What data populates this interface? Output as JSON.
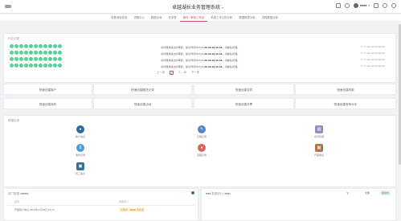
{
  "header": {
    "title": "卓越湖长业务管理系统",
    "title_arrow": "▾",
    "user_name": "■■■■",
    "user_arrow": "▾"
  },
  "nav": {
    "items": [
      "查看消息信息",
      "流程中心",
      "数据仓库",
      "任务表",
      "事件 / 审批工作台",
      "系统工作日历分析",
      "数据报表分析",
      "流程数据分析"
    ],
    "active_index": 4
  },
  "approval": {
    "title": "代办记录",
    "rows": [
      {
        "text": "请处理我提交的审批，提交时间为2021-■■-■■ ■■:■■:■■，请前往处理。",
        "time": "2021-■■-■■ ■■:■■:■■"
      },
      {
        "text": "请处理我提交的审批，提交时间为2021-■■-■■ ■■:■■:■■，请前往处理。",
        "time": "2021-■■-■■ ■■:■■:■■"
      },
      {
        "text": "请处理我提交的审批，提交时间为2021-■■-■■ ■■:■■:■■，请前往处理。",
        "time": "2021-■■-■■ ■■:■■:■■"
      },
      {
        "text": "请处理我提交的审批，提交时间为2021-■■-■■ ■■:■■:■■，请前往处理。",
        "time": "2021-■■-■■ ■■:■■:■■"
      }
    ],
    "pager": {
      "prev": "上一页",
      "current": "1",
      "next_pages": "2 ... 16",
      "next": "下一页"
    }
  },
  "quick_actions": [
    "快速创建客户",
    "快速创建跟进记录",
    "快速创建合同",
    "快速创建收款",
    "快速创建商机",
    "快速创建活动",
    "快速创建开票",
    "快速创建竞争对手"
  ],
  "tools": {
    "title": "快捷应用",
    "items": [
      {
        "label": "客户信息",
        "icon": "user-icon",
        "color": "#2d6aa0"
      },
      {
        "label": "日程记录",
        "icon": "pencil-icon",
        "color": "#5585c2"
      },
      {
        "label": "合同管理",
        "icon": "doc-icon",
        "color": "#9c8bbf"
      },
      {
        "label": "收款记录",
        "icon": "info-icon",
        "color": "#4a9be0"
      },
      {
        "label": "流程记录",
        "icon": "clip-icon",
        "color": "#d46655"
      },
      {
        "label": "开票信息",
        "icon": "invoice-icon",
        "color": "#b0724a"
      },
      {
        "label": "员工信息",
        "icon": "user-card-icon",
        "color": "#3a6f9a"
      }
    ]
  },
  "bottom_left": {
    "title": "部门数据 (■■■■)",
    "col1": "名称",
    "col2": "所属部门",
    "row_text": "开票客户信息 2020年12月02日 15:24",
    "row_badge": "处理中 · ■■■■ 待处理"
  },
  "bottom_right": {
    "title": "■■■ 数据统计 (■■■)",
    "filter_label": "全部",
    "tag": "跟进中"
  }
}
